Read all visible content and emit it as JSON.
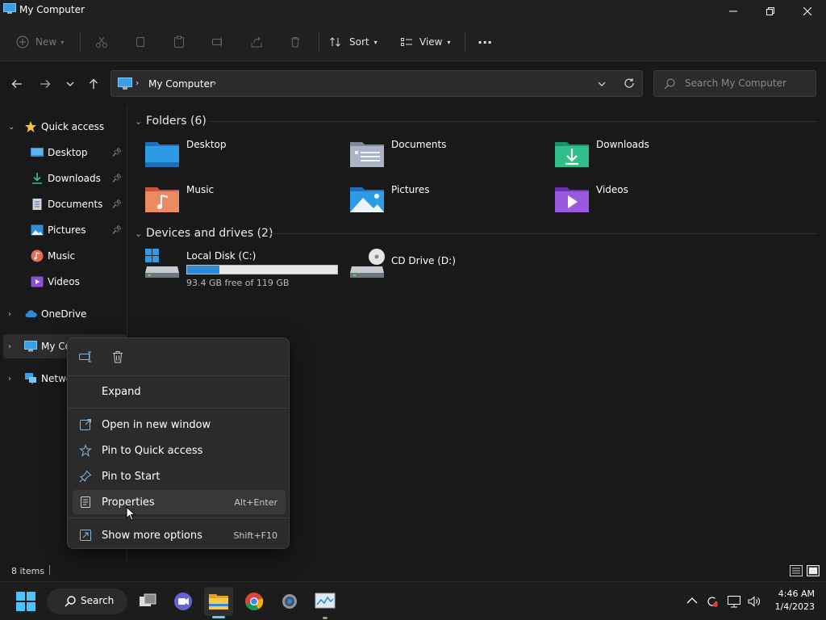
{
  "window": {
    "title": "My Computer",
    "controls": [
      "minimize",
      "restore",
      "close"
    ]
  },
  "toolbar": {
    "new_label": "New",
    "sort_label": "Sort",
    "view_label": "View",
    "more_label": "···"
  },
  "address": {
    "crumb": "My Computer",
    "search_placeholder": "Search My Computer"
  },
  "sidebar": {
    "quick_access": "Quick access",
    "items": [
      {
        "label": "Desktop",
        "pinned": true
      },
      {
        "label": "Downloads",
        "pinned": true
      },
      {
        "label": "Documents",
        "pinned": true
      },
      {
        "label": "Pictures",
        "pinned": true
      },
      {
        "label": "Music",
        "pinned": false
      },
      {
        "label": "Videos",
        "pinned": false
      }
    ],
    "onedrive": "OneDrive",
    "mycomputer": "My Co",
    "network": "Netwo"
  },
  "folders": {
    "header": "Folders (6)",
    "items": [
      {
        "name": "Desktop"
      },
      {
        "name": "Documents"
      },
      {
        "name": "Downloads"
      },
      {
        "name": "Music"
      },
      {
        "name": "Pictures"
      },
      {
        "name": "Videos"
      }
    ]
  },
  "drives": {
    "header": "Devices and drives (2)",
    "local": {
      "name": "Local Disk (C:)",
      "free_text": "93.4 GB free of 119 GB",
      "used_fraction": 0.215
    },
    "cd": {
      "name": "CD Drive (D:)"
    }
  },
  "status": {
    "item_count": "8 items"
  },
  "context_menu": {
    "expand": "Expand",
    "open_new_window": "Open in new window",
    "pin_quick_access": "Pin to Quick access",
    "pin_start": "Pin to Start",
    "properties": "Properties",
    "properties_shortcut": "Alt+Enter",
    "more_options": "Show more options",
    "more_options_shortcut": "Shift+F10"
  },
  "taskbar": {
    "search_label": "Search",
    "time": "4:46 AM",
    "date": "1/4/2023"
  },
  "colors": {
    "accent": "#2b8ad8",
    "window_bg": "#191919",
    "menu_bg": "#2b2b2b"
  }
}
